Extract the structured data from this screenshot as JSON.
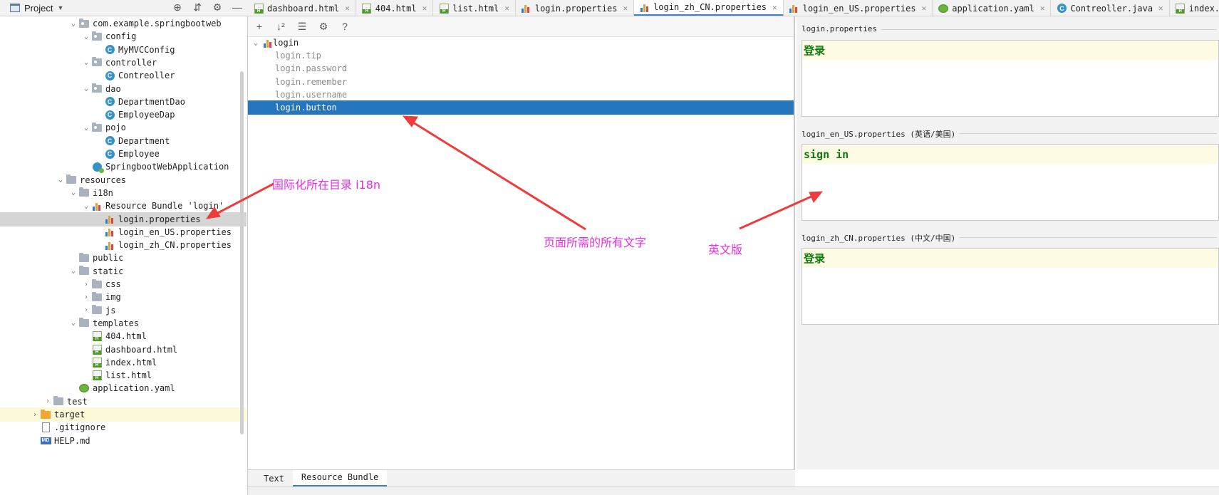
{
  "project": {
    "title": "Project",
    "tree": [
      {
        "label": "com.example.springbootweb",
        "indent": 0,
        "chevron": "down",
        "icon": "package-folder"
      },
      {
        "label": "config",
        "indent": 1,
        "chevron": "down",
        "icon": "package-folder"
      },
      {
        "label": "MyMVCConfig",
        "indent": 2,
        "chevron": "",
        "icon": "class"
      },
      {
        "label": "controller",
        "indent": 1,
        "chevron": "down",
        "icon": "package-folder"
      },
      {
        "label": "Contreoller",
        "indent": 2,
        "chevron": "",
        "icon": "class"
      },
      {
        "label": "dao",
        "indent": 1,
        "chevron": "down",
        "icon": "package-folder"
      },
      {
        "label": "DepartmentDao",
        "indent": 2,
        "chevron": "",
        "icon": "class"
      },
      {
        "label": "EmployeeDap",
        "indent": 2,
        "chevron": "",
        "icon": "class"
      },
      {
        "label": "pojo",
        "indent": 1,
        "chevron": "down",
        "icon": "package-folder"
      },
      {
        "label": "Department",
        "indent": 2,
        "chevron": "",
        "icon": "class"
      },
      {
        "label": "Employee",
        "indent": 2,
        "chevron": "",
        "icon": "class"
      },
      {
        "label": "SpringbootWebApplication",
        "indent": 1,
        "chevron": "",
        "icon": "spring-class"
      },
      {
        "label": "resources",
        "indent": -1,
        "chevron": "down",
        "icon": "resources-folder"
      },
      {
        "label": "i18n",
        "indent": 0,
        "chevron": "down",
        "icon": "folder"
      },
      {
        "label": "Resource Bundle 'login'",
        "indent": 1,
        "chevron": "down",
        "icon": "bundle"
      },
      {
        "label": "login.properties",
        "indent": 2,
        "chevron": "",
        "icon": "properties",
        "state": "selected"
      },
      {
        "label": "login_en_US.properties",
        "indent": 2,
        "chevron": "",
        "icon": "properties"
      },
      {
        "label": "login_zh_CN.properties",
        "indent": 2,
        "chevron": "",
        "icon": "properties"
      },
      {
        "label": "public",
        "indent": 0,
        "chevron": "",
        "icon": "folder"
      },
      {
        "label": "static",
        "indent": 0,
        "chevron": "down",
        "icon": "folder"
      },
      {
        "label": "css",
        "indent": 1,
        "chevron": "right",
        "icon": "folder"
      },
      {
        "label": "img",
        "indent": 1,
        "chevron": "right",
        "icon": "folder"
      },
      {
        "label": "js",
        "indent": 1,
        "chevron": "right",
        "icon": "folder"
      },
      {
        "label": "templates",
        "indent": 0,
        "chevron": "down",
        "icon": "folder"
      },
      {
        "label": "404.html",
        "indent": 1,
        "chevron": "",
        "icon": "html"
      },
      {
        "label": "dashboard.html",
        "indent": 1,
        "chevron": "",
        "icon": "html"
      },
      {
        "label": "index.html",
        "indent": 1,
        "chevron": "",
        "icon": "html"
      },
      {
        "label": "list.html",
        "indent": 1,
        "chevron": "",
        "icon": "html"
      },
      {
        "label": "application.yaml",
        "indent": 0,
        "chevron": "",
        "icon": "yaml"
      },
      {
        "label": "test",
        "indent": -2,
        "chevron": "right",
        "icon": "folder"
      },
      {
        "label": "target",
        "indent": -3,
        "chevron": "right",
        "icon": "excluded-folder",
        "state": "highlight"
      },
      {
        "label": ".gitignore",
        "indent": -3,
        "chevron": "",
        "icon": "file"
      },
      {
        "label": "HELP.md",
        "indent": -3,
        "chevron": "",
        "icon": "markdown"
      }
    ]
  },
  "tabs": [
    {
      "label": "dashboard.html",
      "icon": "html",
      "active": false
    },
    {
      "label": "404.html",
      "icon": "html",
      "active": false
    },
    {
      "label": "list.html",
      "icon": "html",
      "active": false
    },
    {
      "label": "login.properties",
      "icon": "properties",
      "active": false
    },
    {
      "label": "login_zh_CN.properties",
      "icon": "properties",
      "active": true
    },
    {
      "label": "login_en_US.properties",
      "icon": "properties",
      "active": false
    },
    {
      "label": "application.yaml",
      "icon": "yaml",
      "active": false
    },
    {
      "label": "Contreoller.java",
      "icon": "class",
      "active": false
    },
    {
      "label": "index.html",
      "icon": "html",
      "active": false
    }
  ],
  "bundle_editor": {
    "toolbar": [
      "add-icon",
      "sort-icon",
      "group-icon",
      "settings-icon",
      "help-icon"
    ],
    "root_key": "login",
    "keys": [
      {
        "label": "login.tip",
        "selected": false
      },
      {
        "label": "login.password",
        "selected": false
      },
      {
        "label": "login.remember",
        "selected": false
      },
      {
        "label": "login.username",
        "selected": false
      },
      {
        "label": "login.button",
        "selected": true
      }
    ],
    "values": [
      {
        "file": "login.properties",
        "value": "登录"
      },
      {
        "file": "login_en_US.properties (英语/美国)",
        "value": "sign in"
      },
      {
        "file": "login_zh_CN.properties (中文/中国)",
        "value": "登录"
      }
    ],
    "bottom_tabs": [
      {
        "label": "Text",
        "active": false
      },
      {
        "label": "Resource Bundle",
        "active": true
      }
    ]
  },
  "annotations": {
    "i18n_dir": "国际化所在目录 i18n",
    "page_text": "页面所需的所有文字",
    "english": "英文版",
    "color": "#e62de6"
  }
}
